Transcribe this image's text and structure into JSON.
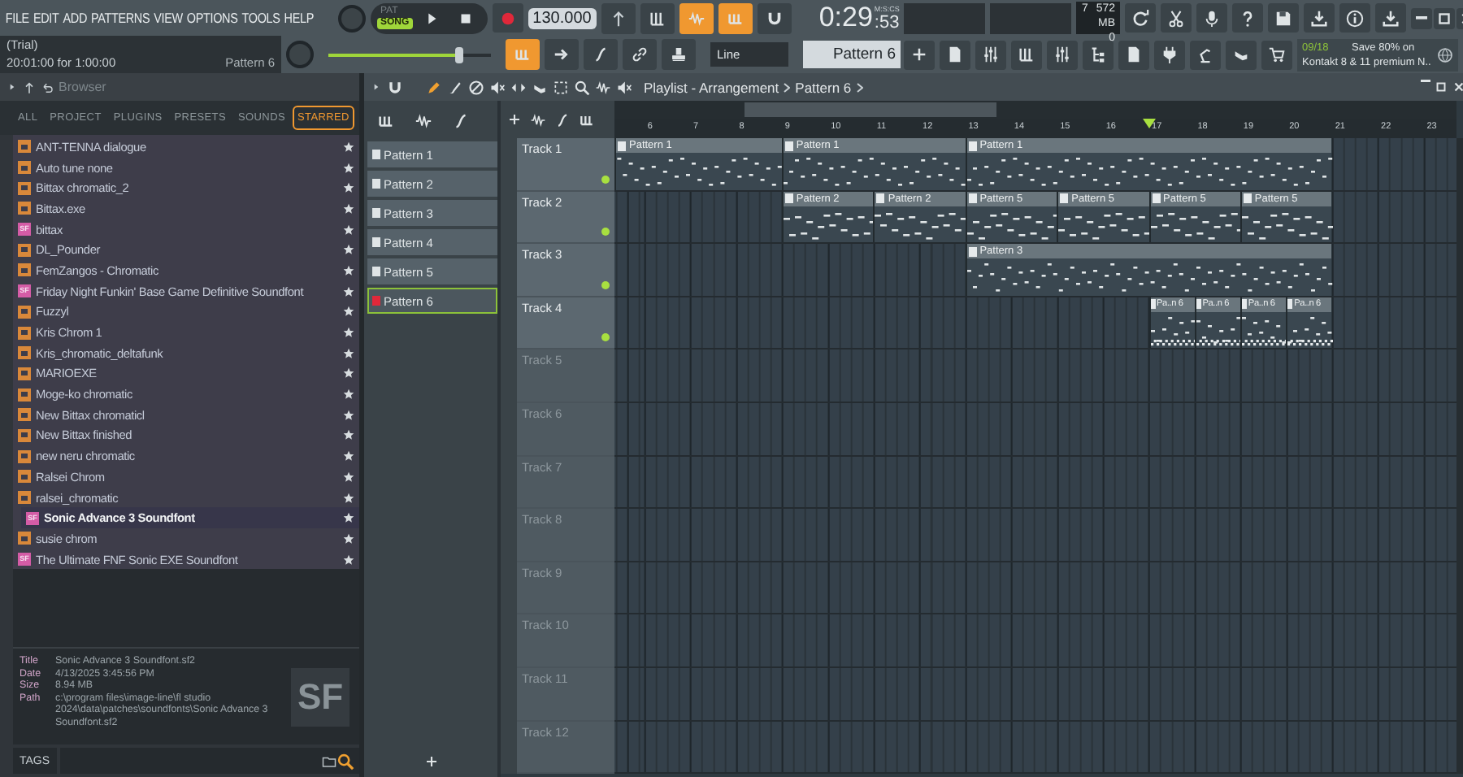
{
  "menu": [
    "FILE",
    "EDIT",
    "ADD",
    "PATTERNS",
    "VIEW",
    "OPTIONS",
    "TOOLS",
    "HELP"
  ],
  "hint": {
    "line_1": "(Trial)",
    "line_2": "20:01:00 for 1:00:00",
    "pattern": "Pattern 6"
  },
  "transport": {
    "modes": [
      {
        "label": "PAT",
        "selected": false
      },
      {
        "label": "SONG",
        "selected": true
      }
    ],
    "tempo": "130.000",
    "master_volume": {
      "level": 0.8
    }
  },
  "toggles_top": [
    {
      "on": false
    },
    {
      "on": false
    },
    {
      "on": true
    },
    {
      "on": true
    },
    {
      "on": false
    }
  ],
  "toggles_bottom": [
    {
      "on": true
    },
    {
      "on": false
    },
    {
      "on": false
    },
    {
      "on": false
    },
    {
      "on": false
    }
  ],
  "snap": "Line",
  "time": {
    "main": "0:29",
    "sub": ":53",
    "unit": "M:S:CS"
  },
  "cpu": {
    "polyphony": "7",
    "memory": "572 MB",
    "value": "0"
  },
  "pattern_selector": "Pattern 6",
  "news": {
    "counter": "09/18",
    "line_1": "Save 80% on",
    "line_2": "Kontakt 8 & 11 premium N.."
  },
  "browser": {
    "title": "Browser",
    "tabs": [
      {
        "label": "ALL",
        "selected": false
      },
      {
        "label": "PROJECT",
        "selected": false
      },
      {
        "label": "PLUGINS",
        "selected": false
      },
      {
        "label": "PRESETS",
        "selected": false
      },
      {
        "label": "SOUNDS",
        "selected": false
      },
      {
        "label": "STARRED",
        "selected": true
      }
    ],
    "items": [
      {
        "name": "ANT-TENNA dialogue",
        "kind": "folder",
        "starred": true,
        "selected": false
      },
      {
        "name": "Auto tune none",
        "kind": "folder",
        "starred": true,
        "selected": false
      },
      {
        "name": "Bittax chromatic_2",
        "kind": "folder",
        "starred": true,
        "selected": false
      },
      {
        "name": "Bittax.exe",
        "kind": "folder",
        "starred": true,
        "selected": false
      },
      {
        "name": "bittax",
        "kind": "soundfont",
        "badge": "SF",
        "starred": true,
        "selected": false
      },
      {
        "name": "DL_Pounder",
        "kind": "folder",
        "starred": true,
        "selected": false
      },
      {
        "name": "FemZangos - Chromatic",
        "kind": "folder",
        "starred": true,
        "selected": false
      },
      {
        "name": "Friday Night Funkin' Base Game Definitive Soundfont",
        "kind": "soundfont",
        "badge": "SF",
        "starred": true,
        "selected": false
      },
      {
        "name": "Fuzzyl",
        "kind": "folder",
        "starred": true,
        "selected": false
      },
      {
        "name": "Kris Chrom 1",
        "kind": "folder",
        "starred": true,
        "selected": false
      },
      {
        "name": "Kris_chromatic_deltafunk",
        "kind": "folder",
        "starred": true,
        "selected": false
      },
      {
        "name": "MARIOEXE",
        "kind": "folder",
        "starred": true,
        "selected": false
      },
      {
        "name": "Moge-ko chromatic",
        "kind": "folder",
        "starred": true,
        "selected": false
      },
      {
        "name": "New Bittax chromaticl",
        "kind": "folder",
        "starred": true,
        "selected": false
      },
      {
        "name": "New Bittax finished",
        "kind": "folder",
        "starred": true,
        "selected": false
      },
      {
        "name": "new neru chromatic",
        "kind": "folder",
        "starred": true,
        "selected": false
      },
      {
        "name": "Ralsei Chrom",
        "kind": "folder",
        "starred": true,
        "selected": false
      },
      {
        "name": "ralsei_chromatic",
        "kind": "folder",
        "starred": true,
        "selected": false
      },
      {
        "name": "Sonic Advance 3 Soundfont",
        "kind": "soundfont",
        "badge": "SF",
        "starred": true,
        "selected": true
      },
      {
        "name": "susie chrom",
        "kind": "folder",
        "starred": true,
        "selected": false
      },
      {
        "name": "The Ultimate FNF Sonic EXE Soundfont",
        "kind": "soundfont",
        "badge": "SF",
        "starred": true,
        "selected": false
      }
    ],
    "info": {
      "fields": [
        {
          "label": "Title",
          "value": "Sonic Advance 3 Soundfont.sf2"
        },
        {
          "label": "Date",
          "value": "4/13/2025 3:45:56 PM"
        },
        {
          "label": "Size",
          "value": "8.94 MB"
        },
        {
          "label": "Path",
          "value": "c:\\program files\\image-line\\fl studio 2024\\data\\patches\\soundfonts\\Sonic Advance 3 Soundfont.sf2"
        }
      ],
      "preview": "SF"
    },
    "tags_button": "TAGS"
  },
  "patterns": [
    {
      "name": "Pattern 1",
      "selected": false
    },
    {
      "name": "Pattern 2",
      "selected": false
    },
    {
      "name": "Pattern 3",
      "selected": false
    },
    {
      "name": "Pattern 4",
      "selected": false
    },
    {
      "name": "Pattern 5",
      "selected": false
    },
    {
      "name": "Pattern 6",
      "selected": true
    }
  ],
  "playlist": {
    "title": "Playlist - Arrangement",
    "pattern": "Pattern 6",
    "ruler": [
      {
        "label": "6",
        "playhead": false
      },
      {
        "label": "7",
        "playhead": false
      },
      {
        "label": "8",
        "playhead": false
      },
      {
        "label": "9",
        "playhead": false
      },
      {
        "label": "10",
        "playhead": false
      },
      {
        "label": "11",
        "playhead": false
      },
      {
        "label": "12",
        "playhead": false
      },
      {
        "label": "13",
        "playhead": false
      },
      {
        "label": "14",
        "playhead": false
      },
      {
        "label": "15",
        "playhead": false
      },
      {
        "label": "16",
        "playhead": false
      },
      {
        "label": "17",
        "playhead": true
      },
      {
        "label": "18",
        "playhead": false
      },
      {
        "label": "19",
        "playhead": false
      },
      {
        "label": "20",
        "playhead": false
      },
      {
        "label": "21",
        "playhead": false
      },
      {
        "label": "22",
        "playhead": false
      },
      {
        "label": "23",
        "playhead": false
      }
    ],
    "tracks": [
      {
        "name": "Track 1",
        "enabled": true,
        "clips": [
          {
            "label": "Pattern 1"
          },
          {
            "label": "Pattern 1"
          },
          {
            "label": "Pattern 1"
          }
        ]
      },
      {
        "name": "Track 2",
        "enabled": true,
        "clips": [
          {
            "label": "Pattern 2"
          },
          {
            "label": "Pattern 2"
          },
          {
            "label": "Pattern 5"
          },
          {
            "label": "Pattern 5"
          },
          {
            "label": "Pattern 5"
          },
          {
            "label": "Pattern 5"
          }
        ]
      },
      {
        "name": "Track 3",
        "enabled": true,
        "clips": [
          {
            "label": "Pattern 3"
          }
        ]
      },
      {
        "name": "Track 4",
        "enabled": true,
        "clips": [
          {
            "label": "Pa..n 6"
          },
          {
            "label": "Pa..n 6"
          },
          {
            "label": "Pa..n 6"
          },
          {
            "label": "Pa..n 6"
          }
        ]
      },
      {
        "name": "Track 5",
        "enabled": false
      },
      {
        "name": "Track 6",
        "enabled": false
      },
      {
        "name": "Track 7",
        "enabled": false
      },
      {
        "name": "Track 8",
        "enabled": false
      },
      {
        "name": "Track 9",
        "enabled": false
      },
      {
        "name": "Track 10",
        "enabled": false
      },
      {
        "name": "Track 11",
        "enabled": false
      },
      {
        "name": "Track 12",
        "enabled": false
      }
    ]
  }
}
